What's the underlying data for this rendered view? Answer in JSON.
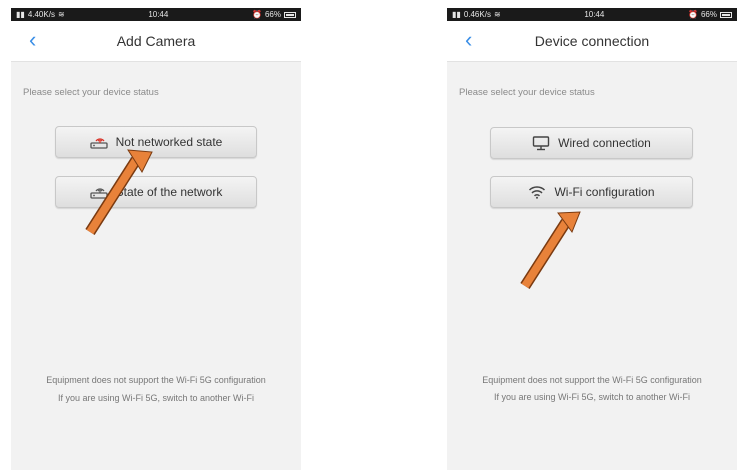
{
  "left_screen": {
    "status": {
      "network": "4.40K/s",
      "time": "10:44",
      "battery": "66%",
      "battery_level": 0.66
    },
    "title": "Add Camera",
    "prompt": "Please select your device status",
    "buttons": [
      {
        "label": "Not networked state",
        "icon": "router-icon-red"
      },
      {
        "label": "State of the network",
        "icon": "router-icon"
      }
    ],
    "footer": [
      "Equipment does not support the Wi-Fi 5G configuration",
      "If you are using Wi-Fi 5G, switch to another Wi-Fi"
    ]
  },
  "right_screen": {
    "status": {
      "network": "0.46K/s",
      "time": "10:44",
      "battery": "66%",
      "battery_level": 0.66
    },
    "title": "Device connection",
    "prompt": "Please select your device status",
    "buttons": [
      {
        "label": "Wired connection",
        "icon": "monitor-icon"
      },
      {
        "label": "Wi-Fi configuration",
        "icon": "wifi-icon"
      }
    ],
    "footer": [
      "Equipment does not support the Wi-Fi 5G configuration",
      "If you are using Wi-Fi 5G, switch to another Wi-Fi"
    ]
  },
  "colors": {
    "accent": "#3a8ee6",
    "arrow": "#e8823a",
    "router_red": "#d93025"
  }
}
